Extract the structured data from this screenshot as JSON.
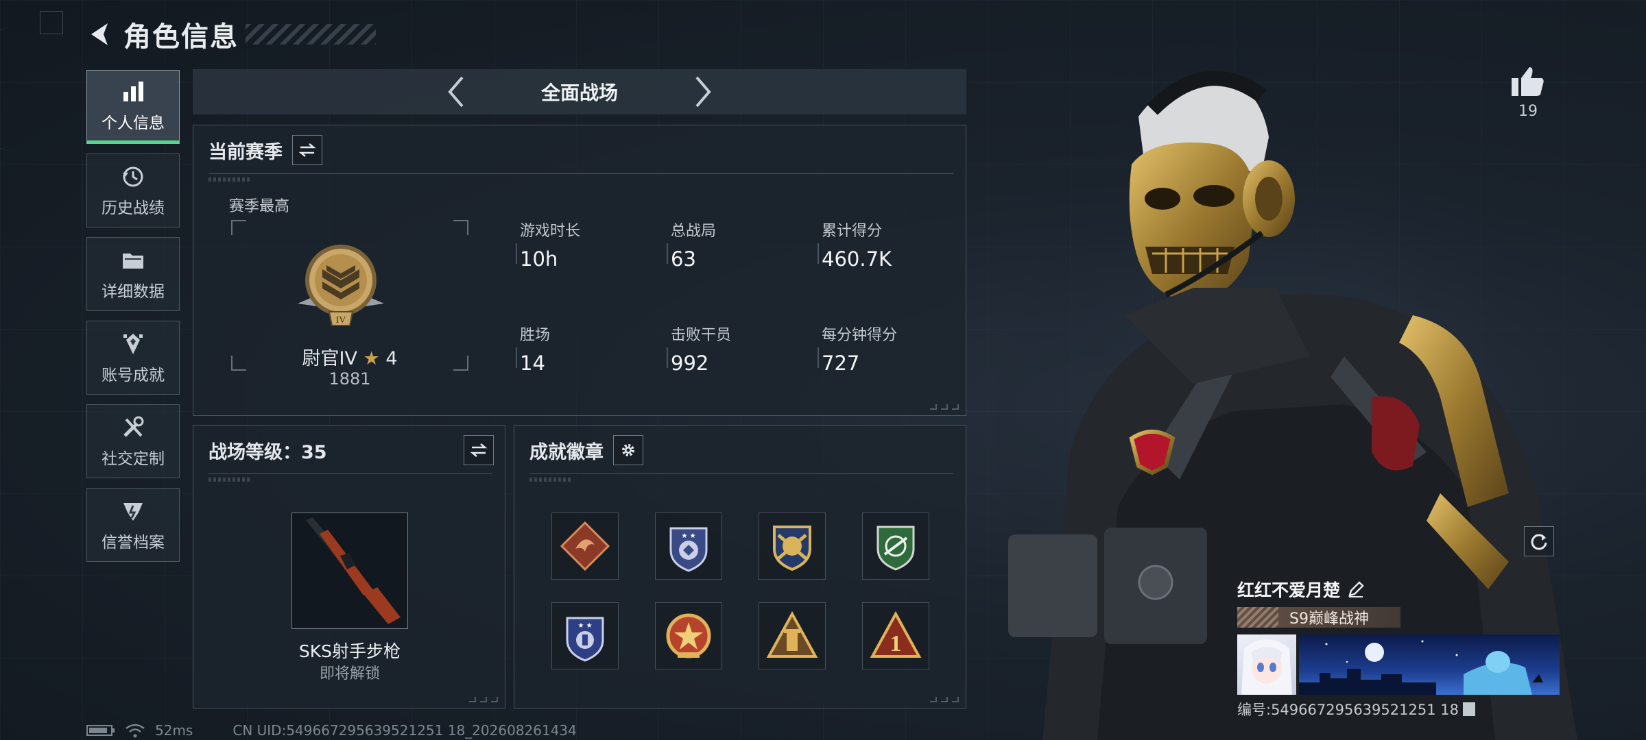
{
  "header": {
    "title": "角色信息"
  },
  "sidebar": {
    "items": [
      {
        "label": "个人信息",
        "icon": "bar-chart-icon",
        "active": true
      },
      {
        "label": "历史战绩",
        "icon": "history-icon",
        "active": false
      },
      {
        "label": "详细数据",
        "icon": "folder-icon",
        "active": false
      },
      {
        "label": "账号成就",
        "icon": "achievement-icon",
        "active": false
      },
      {
        "label": "社交定制",
        "icon": "tools-icon",
        "active": false
      },
      {
        "label": "信誉档案",
        "icon": "credit-icon",
        "active": false
      }
    ]
  },
  "mode": {
    "title": "全面战场"
  },
  "season": {
    "title": "当前赛季",
    "best_label": "赛季最高",
    "rank_name": "尉官IV",
    "rank_stars": "4",
    "rank_score": "1881",
    "stats": [
      {
        "label": "游戏时长",
        "value": "10h"
      },
      {
        "label": "总战局",
        "value": "63"
      },
      {
        "label": "累计得分",
        "value": "460.7K"
      },
      {
        "label": "胜场",
        "value": "14"
      },
      {
        "label": "击败干员",
        "value": "992"
      },
      {
        "label": "每分钟得分",
        "value": "727"
      }
    ]
  },
  "battlefield": {
    "title": "战场等级：35",
    "weapon_name": "SKS射手步枪",
    "weapon_status": "即将解锁"
  },
  "badges": {
    "title": "成就徽章",
    "items": [
      "dragon-badge-icon",
      "shield-star-badge-icon",
      "crossed-gold-badge-icon",
      "green-target-badge-icon",
      "blue-shield-badge-icon",
      "star-medal-badge-icon",
      "triangle-tower-badge-icon",
      "number-one-badge-icon"
    ]
  },
  "likes": {
    "count": "19"
  },
  "player": {
    "name": "红红不爱月楚",
    "title": "S9巅峰战神",
    "id_text": "编号:549667295639521251 18"
  },
  "status": {
    "ping": "52ms",
    "uid": "CN UID:549667295639521251 18_202608261434"
  },
  "colors": {
    "accent_green": "#4fd98a",
    "panel_bg": "#1c242d",
    "gold": "#c9a24a"
  }
}
